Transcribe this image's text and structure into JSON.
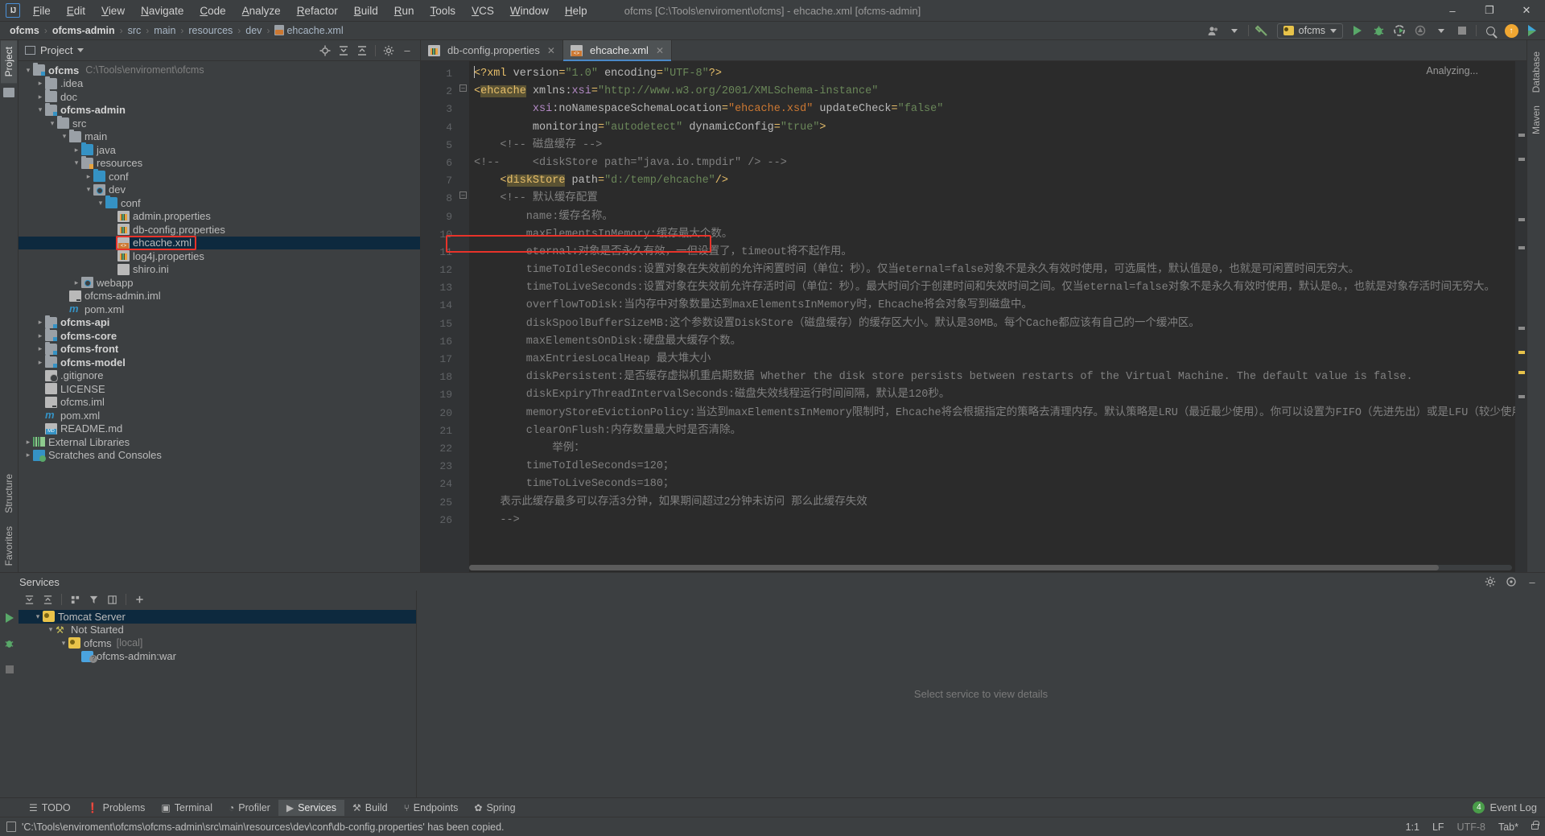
{
  "window": {
    "title": "ofcms [C:\\Tools\\enviroment\\ofcms] - ehcache.xml [ofcms-admin]",
    "minimize": "–",
    "maximize": "❐",
    "close": "✕",
    "logo": "IJ"
  },
  "menu": [
    "File",
    "Edit",
    "View",
    "Navigate",
    "Code",
    "Analyze",
    "Refactor",
    "Build",
    "Run",
    "Tools",
    "VCS",
    "Window",
    "Help"
  ],
  "breadcrumb": [
    {
      "label": "ofcms",
      "bold": true
    },
    {
      "label": "ofcms-admin",
      "bold": true
    },
    {
      "label": "src",
      "bold": false
    },
    {
      "label": "main",
      "bold": false
    },
    {
      "label": "resources",
      "bold": false
    },
    {
      "label": "dev",
      "bold": false
    },
    {
      "label": "ehcache.xml",
      "bold": false,
      "icon": "xml-file-icon"
    }
  ],
  "toolbar": {
    "run_config": "ofcms",
    "icons": [
      "user-icon",
      "hammer-icon",
      "run-icon",
      "debug-icon",
      "run-with-coverage-icon",
      "profile-icon",
      "stop-icon",
      "search-everywhere-icon",
      "update-project-icon",
      "play-store-icon"
    ]
  },
  "sidebar_left_tabs": [
    "Project",
    "Structure",
    "Favorites"
  ],
  "sidebar_right_tabs": [
    "Database",
    "Maven"
  ],
  "project_panel": {
    "title": "Project",
    "actions": [
      "locate-icon",
      "expand-all-icon",
      "collapse-all-icon",
      "settings-icon",
      "hide-icon"
    ],
    "tree": [
      {
        "indent": 0,
        "arrow": "∨",
        "icon": "module",
        "label": "ofcms",
        "bold": true,
        "path": "C:\\Tools\\enviroment\\ofcms"
      },
      {
        "indent": 1,
        "arrow": "›",
        "icon": "folder",
        "label": ".idea",
        "bold": false
      },
      {
        "indent": 1,
        "arrow": "›",
        "icon": "folder",
        "label": "doc",
        "bold": false
      },
      {
        "indent": 1,
        "arrow": "∨",
        "icon": "module",
        "label": "ofcms-admin",
        "bold": true
      },
      {
        "indent": 2,
        "arrow": "∨",
        "icon": "folder",
        "label": "src",
        "bold": false
      },
      {
        "indent": 3,
        "arrow": "∨",
        "icon": "folder",
        "label": "main",
        "bold": false
      },
      {
        "indent": 4,
        "arrow": "›",
        "icon": "folder-blue",
        "label": "java",
        "bold": false
      },
      {
        "indent": 4,
        "arrow": "∨",
        "icon": "res",
        "label": "resources",
        "bold": false
      },
      {
        "indent": 5,
        "arrow": "›",
        "icon": "folder-blue",
        "label": "conf",
        "bold": false
      },
      {
        "indent": 5,
        "arrow": "∨",
        "icon": "dot",
        "label": "dev",
        "bold": false
      },
      {
        "indent": 6,
        "arrow": "∨",
        "icon": "folder-blue",
        "label": "conf",
        "bold": false
      },
      {
        "indent": 7,
        "arrow": "",
        "icon": "props",
        "label": "admin.properties",
        "bold": false
      },
      {
        "indent": 7,
        "arrow": "",
        "icon": "props",
        "label": "db-config.properties",
        "bold": false
      },
      {
        "indent": 7,
        "arrow": "",
        "icon": "xml",
        "label": "ehcache.xml",
        "bold": false,
        "selected": true,
        "highlighted": true
      },
      {
        "indent": 7,
        "arrow": "",
        "icon": "props",
        "label": "log4j.properties",
        "bold": false
      },
      {
        "indent": 7,
        "arrow": "",
        "icon": "file",
        "label": "shiro.ini",
        "bold": false
      },
      {
        "indent": 4,
        "arrow": "›",
        "icon": "dot",
        "label": "webapp",
        "bold": false
      },
      {
        "indent": 3,
        "arrow": "",
        "icon": "iml",
        "label": "ofcms-admin.iml",
        "bold": false
      },
      {
        "indent": 3,
        "arrow": "",
        "icon": "maven",
        "label": "pom.xml",
        "bold": false
      },
      {
        "indent": 1,
        "arrow": "›",
        "icon": "module",
        "label": "ofcms-api",
        "bold": true
      },
      {
        "indent": 1,
        "arrow": "›",
        "icon": "module",
        "label": "ofcms-core",
        "bold": true
      },
      {
        "indent": 1,
        "arrow": "›",
        "icon": "module",
        "label": "ofcms-front",
        "bold": true
      },
      {
        "indent": 1,
        "arrow": "›",
        "icon": "module",
        "label": "ofcms-model",
        "bold": true
      },
      {
        "indent": 1,
        "arrow": "",
        "icon": "git",
        "label": ".gitignore",
        "bold": false
      },
      {
        "indent": 1,
        "arrow": "",
        "icon": "file",
        "label": "LICENSE",
        "bold": false
      },
      {
        "indent": 1,
        "arrow": "",
        "icon": "iml",
        "label": "ofcms.iml",
        "bold": false
      },
      {
        "indent": 1,
        "arrow": "",
        "icon": "maven",
        "label": "pom.xml",
        "bold": false
      },
      {
        "indent": 1,
        "arrow": "",
        "icon": "md",
        "label": "README.md",
        "bold": false
      },
      {
        "indent": 0,
        "arrow": "›",
        "icon": "lib",
        "label": "External Libraries",
        "bold": false
      },
      {
        "indent": 0,
        "arrow": "›",
        "icon": "scratch",
        "label": "Scratches and Consoles",
        "bold": false
      }
    ]
  },
  "editor": {
    "tabs": [
      {
        "label": "db-config.properties",
        "icon": "properties-file-icon",
        "active": false,
        "close": "✕"
      },
      {
        "label": "ehcache.xml",
        "icon": "xml-file-icon",
        "active": true,
        "close": "✕"
      }
    ],
    "status_right": "Analyzing...",
    "line_numbers": [
      1,
      2,
      3,
      4,
      5,
      6,
      7,
      8,
      9,
      10,
      11,
      12,
      13,
      14,
      15,
      16,
      17,
      18,
      19,
      20,
      21,
      22,
      23,
      24,
      25,
      26
    ],
    "lines": [
      {
        "n": 1,
        "raw": "<?xml version=\"1.0\" encoding=\"UTF-8\"?>"
      },
      {
        "n": 2,
        "raw": "<ehcache xmlns:xsi=\"http://www.w3.org/2001/XMLSchema-instance\""
      },
      {
        "n": 3,
        "raw": "         xsi:noNamespaceSchemaLocation=\"ehcache.xsd\" updateCheck=\"false\""
      },
      {
        "n": 4,
        "raw": "         monitoring=\"autodetect\" dynamicConfig=\"true\">"
      },
      {
        "n": 5,
        "raw": "    <!-- 磁盘缓存 -->"
      },
      {
        "n": 6,
        "raw": "<!--     <diskStore path=\"java.io.tmpdir\" /> -->"
      },
      {
        "n": 7,
        "raw": "    <diskStore path=\"d:/temp/ehcache\"/>"
      },
      {
        "n": 8,
        "raw": "    <!-- 默认缓存配置"
      },
      {
        "n": 9,
        "raw": "        name:缓存名称。"
      },
      {
        "n": 10,
        "raw": "        maxElementsInMemory:缓存最大个数。"
      },
      {
        "n": 11,
        "raw": "        eternal:对象是否永久有效，一但设置了，timeout将不起作用。"
      },
      {
        "n": 12,
        "raw": "        timeToIdleSeconds:设置对象在失效前的允许闲置时间（单位：秒）。仅当eternal=false对象不是永久有效时使用，可选属性，默认值是0，也就是可闲置时间无穷大。"
      },
      {
        "n": 13,
        "raw": "        timeToLiveSeconds:设置对象在失效前允许存活时间（单位：秒）。最大时间介于创建时间和失效时间之间。仅当eternal=false对象不是永久有效时使用，默认是0。，也就是对象存活时间无穷大。"
      },
      {
        "n": 14,
        "raw": "        overflowToDisk:当内存中对象数量达到maxElementsInMemory时，Ehcache将会对象写到磁盘中。"
      },
      {
        "n": 15,
        "raw": "        diskSpoolBufferSizeMB:这个参数设置DiskStore（磁盘缓存）的缓存区大小。默认是30MB。每个Cache都应该有自己的一个缓冲区。"
      },
      {
        "n": 16,
        "raw": "        maxElementsOnDisk:硬盘最大缓存个数。"
      },
      {
        "n": 17,
        "raw": "        maxEntriesLocalHeap 最大堆大小"
      },
      {
        "n": 18,
        "raw": "        diskPersistent:是否缓存虚拟机重启期数据 Whether the disk store persists between restarts of the Virtual Machine. The default value is false."
      },
      {
        "n": 19,
        "raw": "        diskExpiryThreadIntervalSeconds:磁盘失效线程运行时间间隔，默认是120秒。"
      },
      {
        "n": 20,
        "raw": "        memoryStoreEvictionPolicy:当达到maxElementsInMemory限制时，Ehcache将会根据指定的策略去清理内存。默认策略是LRU（最近最少使用）。你可以设置为FIFO（先进先出）或是LFU（较少使用）。"
      },
      {
        "n": 21,
        "raw": "        clearOnFlush:内存数量最大时是否清除。"
      },
      {
        "n": 22,
        "raw": "            举例："
      },
      {
        "n": 23,
        "raw": "        timeToIdleSeconds=120；"
      },
      {
        "n": 24,
        "raw": "        timeToLiveSeconds=180；"
      },
      {
        "n": 25,
        "raw": "    表示此缓存最多可以存活3分钟，如果期间超过2分钟未访问 那么此缓存失效"
      },
      {
        "n": 26,
        "raw": "    -->"
      }
    ]
  },
  "services": {
    "title": "Services",
    "toolbar": [
      "run-icon",
      "expand-all-icon",
      "collapse-all-icon",
      "group-icon",
      "filter-icon",
      "layout-icon",
      "add-icon"
    ],
    "gutter": [
      "run-icon",
      "debug-icon",
      "stop-icon"
    ],
    "tree": [
      {
        "indent": 0,
        "arrow": "∨",
        "icon": "tomcat",
        "label": "Tomcat Server",
        "selected": true
      },
      {
        "indent": 1,
        "arrow": "∨",
        "icon": "wrench",
        "label": "Not Started"
      },
      {
        "indent": 2,
        "arrow": "∨",
        "icon": "tomcat",
        "label": "ofcms",
        "suffix": "[local]"
      },
      {
        "indent": 3,
        "arrow": "",
        "icon": "war",
        "label": "ofcms-admin:war"
      }
    ],
    "placeholder": "Select service to view details",
    "actions": [
      "settings-icon",
      "help-icon",
      "hide-icon"
    ]
  },
  "toolwindow_bar": {
    "items": [
      {
        "label": "TODO",
        "icon": "todo-icon",
        "selected": false
      },
      {
        "label": "Problems",
        "icon": "problems-icon",
        "selected": false
      },
      {
        "label": "Terminal",
        "icon": "terminal-icon",
        "selected": false
      },
      {
        "label": "Profiler",
        "icon": "profiler-icon",
        "selected": false
      },
      {
        "label": "Services",
        "icon": "services-icon",
        "selected": true
      },
      {
        "label": "Build",
        "icon": "build-icon",
        "selected": false
      },
      {
        "label": "Endpoints",
        "icon": "endpoints-icon",
        "selected": false
      },
      {
        "label": "Spring",
        "icon": "spring-icon",
        "selected": false
      }
    ],
    "event_log": "Event Log",
    "event_count": "4"
  },
  "status_bar": {
    "message": "'C:\\Tools\\enviroment\\ofcms\\ofcms-admin\\src\\main\\resources\\dev\\conf\\db-config.properties' has been copied.",
    "caret": "1:1",
    "line_sep": "LF",
    "encoding": "UTF-8",
    "indent": "Tab*",
    "lock": "lock-icon"
  },
  "colors": {
    "accent": "#4a88c7",
    "highlight_box": "#e8332a",
    "selection": "#0d293e",
    "editor_bg": "#2b2b2b",
    "panel_bg": "#3c3f41"
  }
}
